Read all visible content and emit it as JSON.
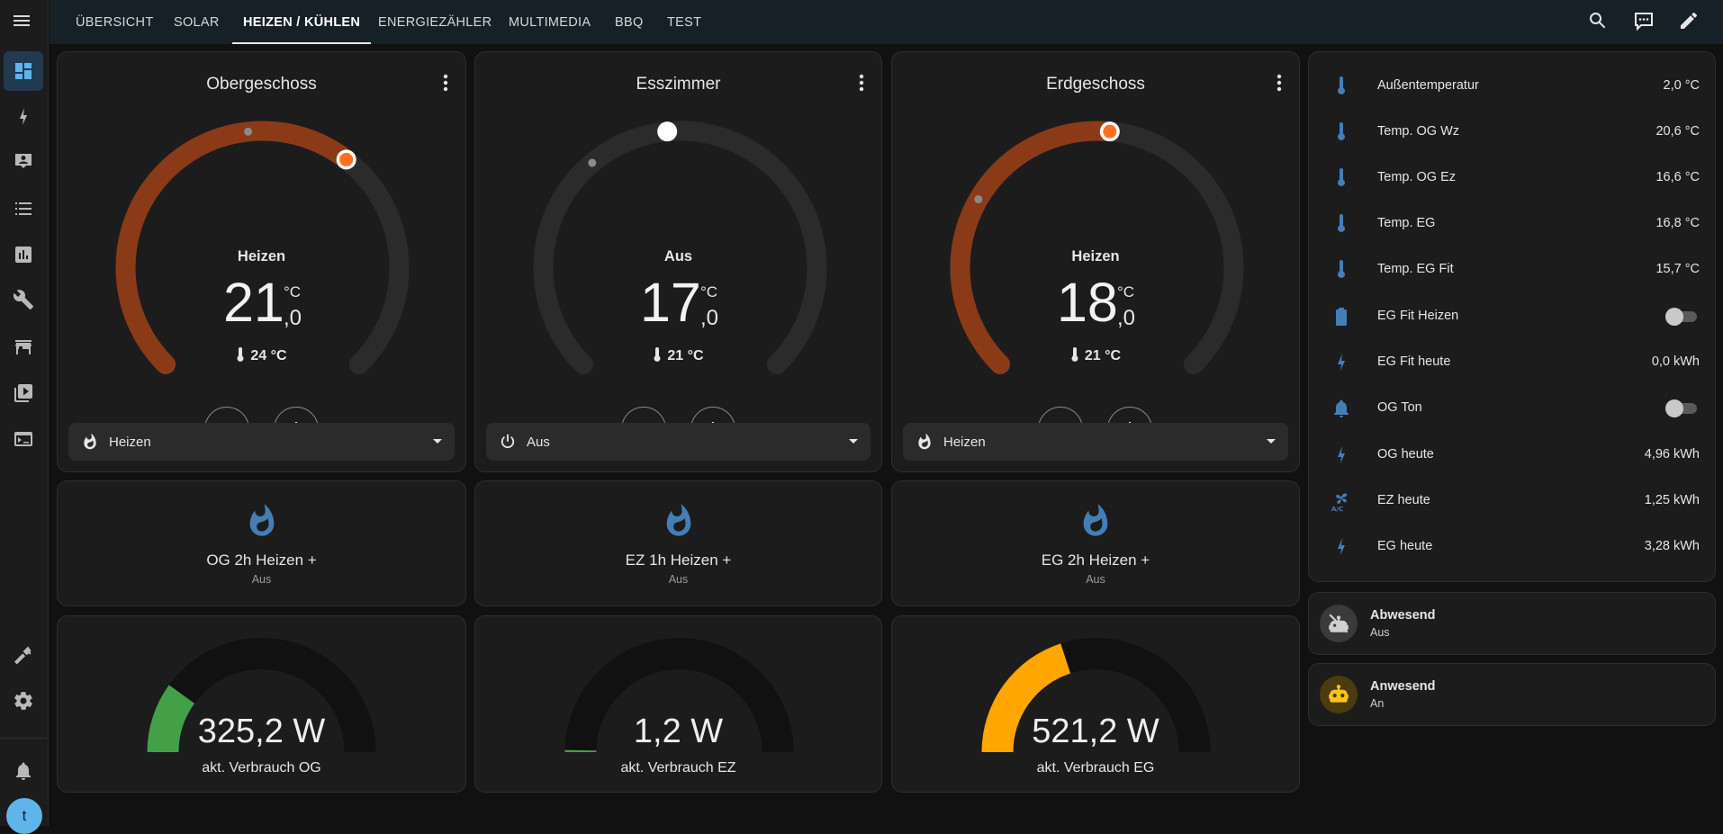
{
  "colors": {
    "accent_blue": "#5fb4ea",
    "heat_orange": "#ff6f22",
    "heat_arc": "#8b3a17",
    "icon_blue": "#447eb7",
    "gauge_green": "#43a047",
    "gauge_amber": "#ffa600",
    "gauge_track": "#111111"
  },
  "sidebar": {
    "items": [
      {
        "icon": "dashboard-icon",
        "active": true
      },
      {
        "icon": "lightning-icon"
      },
      {
        "icon": "account-box-icon"
      },
      {
        "icon": "format-list-icon"
      },
      {
        "icon": "chart-box-icon"
      },
      {
        "icon": "wrench-icon"
      },
      {
        "icon": "store-icon"
      },
      {
        "icon": "media-play-icon"
      },
      {
        "icon": "terminal-icon"
      }
    ],
    "bottom": [
      {
        "icon": "hammer-icon"
      },
      {
        "icon": "cog-icon"
      },
      {
        "icon": "bell-icon"
      }
    ],
    "avatar_letter": "t"
  },
  "topbar": {
    "tabs": [
      "ÜBERSICHT",
      "SOLAR",
      "HEIZEN / KÜHLEN",
      "ENERGIEZÄHLER",
      "MULTIMEDIA",
      "BBQ",
      "TEST"
    ],
    "active_tab": "HEIZEN / KÜHLEN",
    "actions": [
      "search-icon",
      "assist-icon",
      "pencil-icon"
    ]
  },
  "thermostats": [
    {
      "title": "Obergeschoss",
      "hvac_action": "Heizen",
      "target_int": "21",
      "target_dec": ",0",
      "unit": "°C",
      "current": "24 °C",
      "mode": "Heizen",
      "mode_icon": "flame-icon",
      "active": true,
      "min": 5,
      "max": 30,
      "target": 21.0
    },
    {
      "title": "Esszimmer",
      "hvac_action": "Aus",
      "target_int": "17",
      "target_dec": ",0",
      "unit": "°C",
      "current": "21 °C",
      "mode": "Aus",
      "mode_icon": "power-icon",
      "active": false,
      "min": 5,
      "max": 30,
      "target": 17.0
    },
    {
      "title": "Erdgeschoss",
      "hvac_action": "Heizen",
      "target_int": "18",
      "target_dec": ",0",
      "unit": "°C",
      "current": "21 °C",
      "mode": "Heizen",
      "mode_icon": "flame-icon",
      "active": true,
      "min": 5,
      "max": 30,
      "target": 18.0
    }
  ],
  "boost_buttons": [
    {
      "name": "OG 2h Heizen +",
      "state": "Aus"
    },
    {
      "name": "EZ 1h Heizen +",
      "state": "Aus"
    },
    {
      "name": "EG 2h Heizen +",
      "state": "Aus"
    }
  ],
  "power_gauges": [
    {
      "value": "325,2 W",
      "name": "akt. Verbrauch OG",
      "fraction": 0.2,
      "color": "#43a047"
    },
    {
      "value": "1,2 W",
      "name": "akt. Verbrauch EZ",
      "fraction": 0.0,
      "color": "#43a047"
    },
    {
      "value": "521,2 W",
      "name": "akt. Verbrauch EG",
      "fraction": 0.4,
      "color": "#ffa600"
    }
  ],
  "entities": [
    {
      "icon": "thermometer-icon",
      "name": "Außentemperatur",
      "value": "2,0 °C"
    },
    {
      "icon": "thermometer-icon",
      "name": "Temp. OG Wz",
      "value": "20,6 °C"
    },
    {
      "icon": "thermometer-icon",
      "name": "Temp. OG Ez",
      "value": "16,6 °C"
    },
    {
      "icon": "thermometer-icon",
      "name": "Temp. EG",
      "value": "16,8 °C"
    },
    {
      "icon": "thermometer-icon",
      "name": "Temp. EG Fit",
      "value": "15,7 °C"
    },
    {
      "icon": "battery-icon",
      "name": "EG Fit Heizen",
      "value": "",
      "toggle": true,
      "on": false
    },
    {
      "icon": "lightning-icon",
      "name": "EG Fit heute",
      "value": "0,0 kWh"
    },
    {
      "icon": "bell-icon",
      "name": "OG Ton",
      "value": "",
      "toggle": true,
      "on": false
    },
    {
      "icon": "lightning-icon",
      "name": "OG heute",
      "value": "4,96 kWh"
    },
    {
      "icon": "fan-ac-icon",
      "name": "EZ heute",
      "value": "1,25 kWh"
    },
    {
      "icon": "lightning-icon",
      "name": "EG heute",
      "value": "3,28 kWh"
    }
  ],
  "tiles": [
    {
      "icon": "robot-off-icon",
      "name": "Abwesend",
      "state": "Aus"
    },
    {
      "icon": "robot-icon",
      "name": "Anwesend",
      "state": "An"
    }
  ]
}
